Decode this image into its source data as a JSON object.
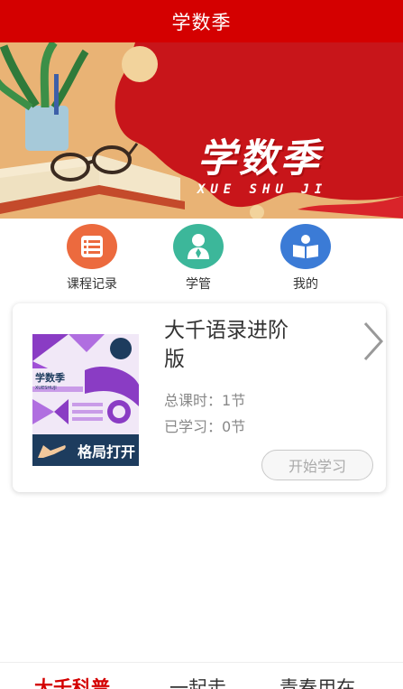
{
  "header": {
    "title": "学数季"
  },
  "banner": {
    "title": "学数季",
    "subtitle": "XUE SHU JI",
    "colors": {
      "red": "#c8151a",
      "sand": "#e9b375",
      "light": "#f2d39c"
    }
  },
  "quick_nav": [
    {
      "label": "课程记录",
      "icon": "list-icon",
      "color": "#ec6a3e"
    },
    {
      "label": "学管",
      "icon": "person-icon",
      "color": "#3cb79a"
    },
    {
      "label": "我的",
      "icon": "book-icon",
      "color": "#3b7bd6"
    }
  ],
  "course": {
    "title": "大千语录进阶版",
    "total_label": "总课时：",
    "total_value": "1节",
    "learned_label": "已学习：",
    "learned_value": "0节",
    "start_button": "开始学习",
    "cover": {
      "brand": "学数季",
      "brand_sub": "XUESHUJI",
      "caption": "格局打开"
    }
  },
  "bottom_tabs": [
    {
      "label": "大千科普",
      "active": true
    },
    {
      "label": "一起走",
      "active": false
    },
    {
      "label": "青春用在",
      "active": false
    }
  ]
}
